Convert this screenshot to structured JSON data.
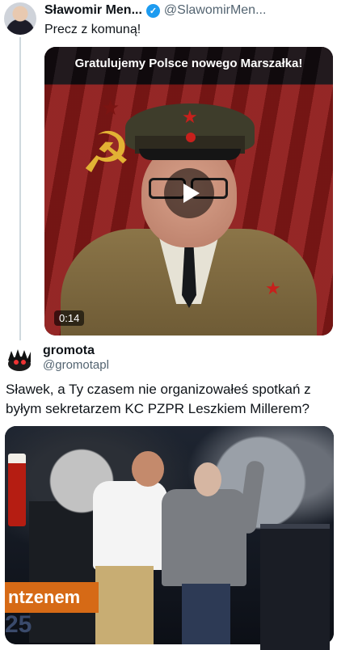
{
  "tweet1": {
    "author_name": "Sławomir Men...",
    "handle": "@SlawomirMen...",
    "text": "Precz z komuną!",
    "video": {
      "banner_text": "Gratulujemy Polsce nowego Marszałka!",
      "duration": "0:14"
    }
  },
  "tweet2": {
    "author_name": "gromota",
    "handle": "@gromotapl",
    "text": "Sławek, a Ty czasem nie organizowałeś spotkań z byłym sekretarzem KC PZPR Leszkiem Millerem?",
    "image": {
      "banner_text": "ntzenem",
      "number_text": "25"
    }
  },
  "colors": {
    "verified_blue": "#1d9bf0",
    "text_secondary": "#536471",
    "thread_line": "#cfd9de"
  }
}
